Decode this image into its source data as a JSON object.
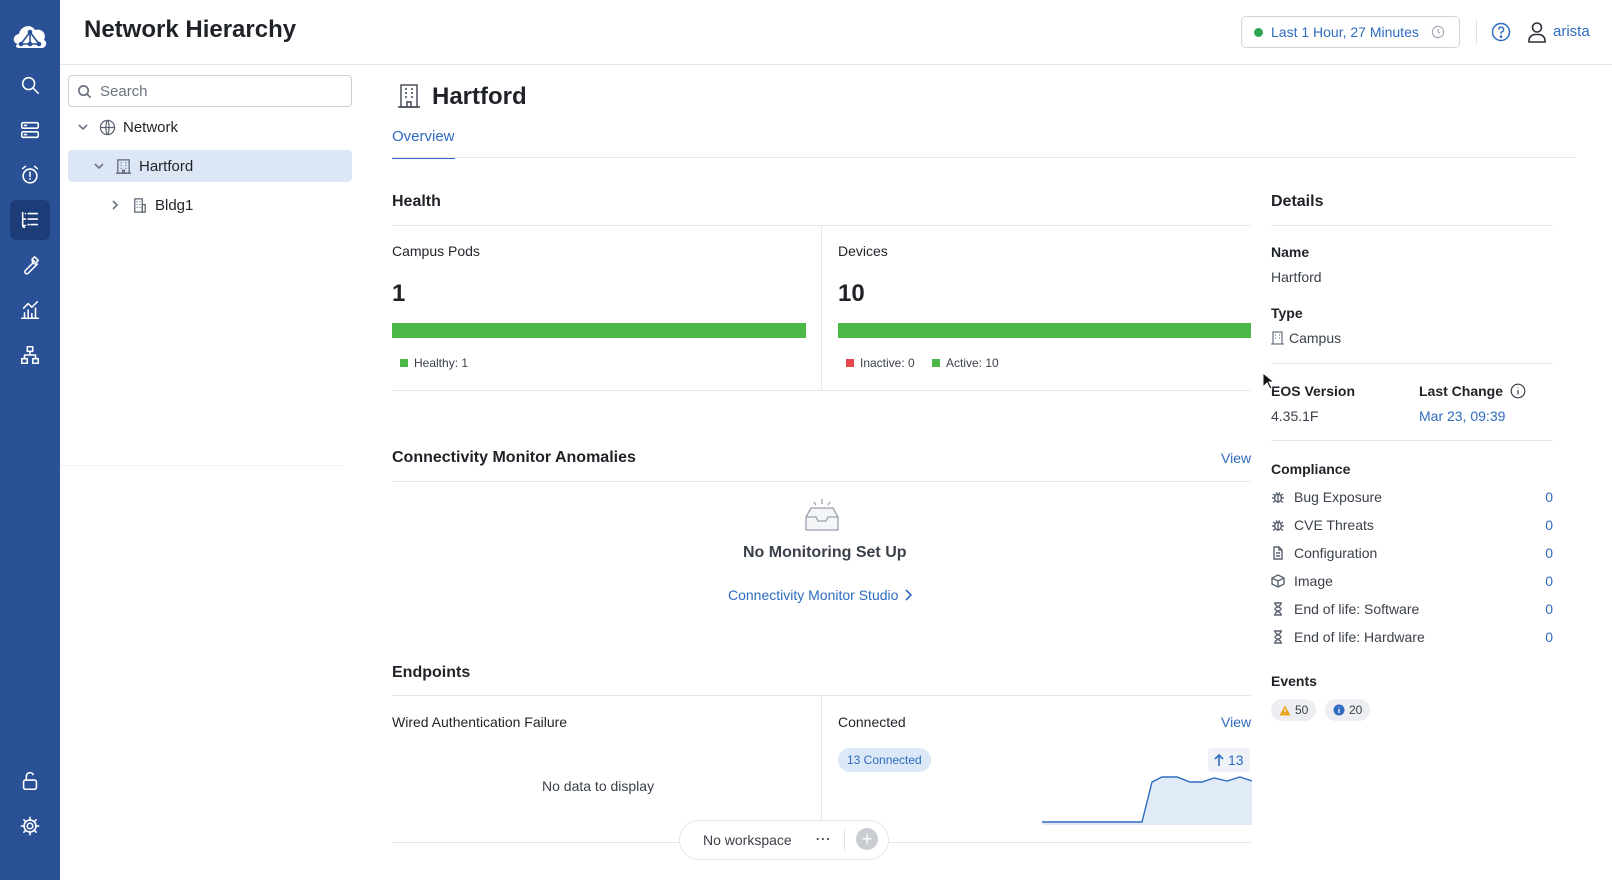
{
  "header": {
    "title": "Network Hierarchy",
    "time_range": "Last 1 Hour, 27 Minutes",
    "user": "arista"
  },
  "rail": {
    "items": [
      "search-icon",
      "inventory-icon",
      "alarm-icon",
      "hierarchy-icon",
      "wrench-icon",
      "dashboards-icon",
      "topology-icon",
      "lock-icon",
      "settings-icon"
    ],
    "active": "hierarchy-icon"
  },
  "tree": {
    "search_placeholder": "Search",
    "nodes": [
      {
        "label": "Network",
        "expanded": true
      },
      {
        "label": "Hartford",
        "expanded": true,
        "selected": true
      },
      {
        "label": "Bldg1",
        "expanded": false
      }
    ]
  },
  "main": {
    "title": "Hartford",
    "tabs": [
      {
        "label": "Overview",
        "active": true
      }
    ],
    "health": {
      "title": "Health",
      "pods": {
        "label": "Campus Pods",
        "value": "1",
        "legend": [
          {
            "label": "Healthy: 1",
            "color": "#4cb848"
          }
        ]
      },
      "devices": {
        "label": "Devices",
        "value": "10",
        "legend": [
          {
            "label": "Inactive: 0",
            "color": "#e5484d"
          },
          {
            "label": "Active: 10",
            "color": "#4cb848"
          }
        ]
      }
    },
    "connectivity": {
      "title": "Connectivity Monitor Anomalies",
      "view": "View",
      "empty_title": "No Monitoring Set Up",
      "studio_link": "Connectivity Monitor Studio"
    },
    "endpoints": {
      "title": "Endpoints",
      "wired_auth": {
        "label": "Wired Authentication Failure",
        "empty": "No data to display"
      },
      "connected": {
        "label": "Connected",
        "view": "View",
        "badge": "13 Connected",
        "trend": "13"
      }
    }
  },
  "details": {
    "title": "Details",
    "name_label": "Name",
    "name_value": "Hartford",
    "type_label": "Type",
    "type_value": "Campus",
    "eos_label": "EOS Version",
    "eos_value": "4.35.1F",
    "last_change_label": "Last Change",
    "last_change_value": "Mar 23, 09:39",
    "compliance_label": "Compliance",
    "compliance": [
      {
        "label": "Bug Exposure",
        "count": "0",
        "icon": "bug-icon"
      },
      {
        "label": "CVE Threats",
        "count": "0",
        "icon": "bug-icon"
      },
      {
        "label": "Configuration",
        "count": "0",
        "icon": "document-icon"
      },
      {
        "label": "Image",
        "count": "0",
        "icon": "cube-icon"
      },
      {
        "label": "End of life: Software",
        "count": "0",
        "icon": "hourglass-icon"
      },
      {
        "label": "End of life: Hardware",
        "count": "0",
        "icon": "hourglass-icon"
      }
    ],
    "events_label": "Events",
    "events": {
      "warning": "50",
      "info": "20"
    }
  },
  "workspace": {
    "label": "No workspace"
  },
  "colors": {
    "rail": "#2a5196",
    "accent": "#2f6bc0",
    "healthy": "#4cb848",
    "inactive": "#e5484d"
  }
}
